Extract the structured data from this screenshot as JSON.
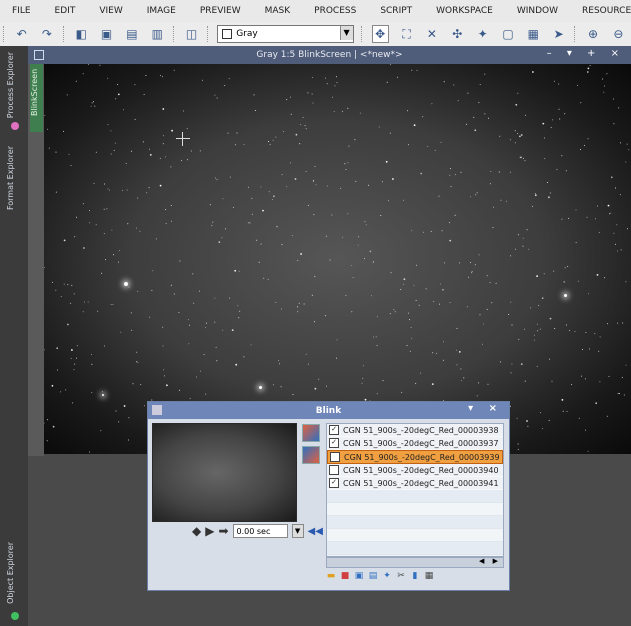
{
  "menu": [
    "FILE",
    "EDIT",
    "VIEW",
    "IMAGE",
    "PREVIEW",
    "MASK",
    "PROCESS",
    "SCRIPT",
    "WORKSPACE",
    "WINDOW",
    "RESOURCES"
  ],
  "toolbar": {
    "colorspace_value": "Gray"
  },
  "left_panel": {
    "tabs": [
      "Process Explorer",
      "Format Explorer",
      "Object Explorer"
    ],
    "blink_tab": "BlinkScreen"
  },
  "image_window": {
    "title": "Gray 1:5 BlinkScreen | <*new*>"
  },
  "blink": {
    "title": "Blink",
    "delay": "0.00 sec",
    "files": [
      {
        "name": "CGN 51_900s_-20degC_Red_00003938",
        "checked": true,
        "selected": false
      },
      {
        "name": "CGN 51_900s_-20degC_Red_00003937",
        "checked": true,
        "selected": false
      },
      {
        "name": "CGN 51_900s_-20degC_Red_00003939",
        "checked": false,
        "selected": true
      },
      {
        "name": "CGN 51_900s_-20degC_Red_00003940",
        "checked": false,
        "selected": false
      },
      {
        "name": "CGN 51_900s_-20degC_Red_00003941",
        "checked": true,
        "selected": false
      }
    ]
  }
}
